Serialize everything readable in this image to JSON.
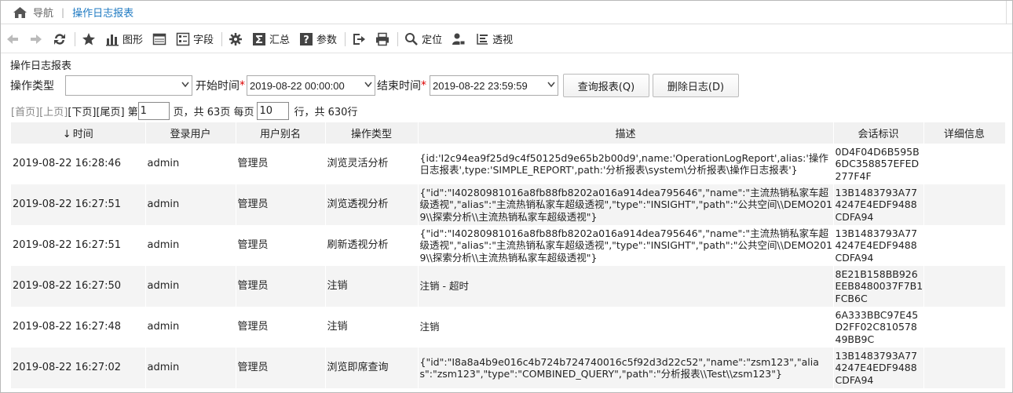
{
  "breadcrumb": {
    "nav": "导航",
    "current": "操作日志报表"
  },
  "toolbar": {
    "chart": "图形",
    "fields": "字段",
    "summary": "汇总",
    "params": "参数",
    "locate": "定位",
    "pivot": "透视"
  },
  "report": {
    "title": "操作日志报表"
  },
  "filter": {
    "op_type_label": "操作类型",
    "op_type_value": "",
    "start_label": "开始时间",
    "start_value": "2019-08-22 00:00:00",
    "end_label": "结束时间",
    "end_value": "2019-08-22 23:59:59",
    "required_mark": "*",
    "query_btn": "查询报表(Q)",
    "delete_btn": "删除日志(D)"
  },
  "paging": {
    "first": "[首页]",
    "prev": "[上页]",
    "next": "[下页]",
    "last": "[尾页]",
    "page_prefix": "第",
    "page_value": "1",
    "page_suffix": "页，共 63页 每页",
    "rows_value": "10",
    "rows_suffix": "行，共 630行"
  },
  "table": {
    "sort_arrow": "↓",
    "headers": [
      "时间",
      "登录用户",
      "用户别名",
      "操作类型",
      "描述",
      "会话标识",
      "详细信息"
    ],
    "rows": [
      {
        "time": "2019-08-22  16:28:46",
        "user": "admin",
        "alias": "管理员",
        "op": "浏览灵活分析",
        "desc": "{id:'I2c94ea9f25d9c4f50125d9e65b2b00d9',name:'OperationLogReport',alias:'操作日志报表',type:'SIMPLE_REPORT',path:'分析报表\\system\\分析报表\\操作日志报表'}",
        "session": "0D4F04D6B595B6DC358857EFED277F4F",
        "detail": ""
      },
      {
        "time": "2019-08-22  16:27:51",
        "user": "admin",
        "alias": "管理员",
        "op": "浏览透视分析",
        "desc": "{\"id\":\"I40280981016a8fb88fb8202a016a914dea795646\",\"name\":\"主流热销私家车超级透视\",\"alias\":\"主流热销私家车超级透视\",\"type\":\"INSIGHT\",\"path\":\"公共空间\\\\DEMO2019\\\\探索分析\\\\主流热销私家车超级透视\"}",
        "session": "13B1483793A774247E4EDF9488CDFA94",
        "detail": ""
      },
      {
        "time": "2019-08-22  16:27:51",
        "user": "admin",
        "alias": "管理员",
        "op": "刷新透视分析",
        "desc": "{\"id\":\"I40280981016a8fb88fb8202a016a914dea795646\",\"name\":\"主流热销私家车超级透视\",\"alias\":\"主流热销私家车超级透视\",\"type\":\"INSIGHT\",\"path\":\"公共空间\\\\DEMO2019\\\\探索分析\\\\主流热销私家车超级透视\"}",
        "session": "13B1483793A774247E4EDF9488CDFA94",
        "detail": ""
      },
      {
        "time": "2019-08-22  16:27:50",
        "user": "admin",
        "alias": "管理员",
        "op": "注销",
        "desc": "注销 - 超时",
        "session": "8E21B158BB926EEB8480037F7B1FCB6C",
        "detail": ""
      },
      {
        "time": "2019-08-22  16:27:48",
        "user": "admin",
        "alias": "管理员",
        "op": "注销",
        "desc": "注销",
        "session": "6A333BBC97E45D2FF02C81057849BB9C",
        "detail": ""
      },
      {
        "time": "2019-08-22  16:27:02",
        "user": "admin",
        "alias": "管理员",
        "op": "浏览即席查询",
        "desc": "{\"id\":\"I8a8a4b9e016c4b724b724740016c5f92d3d22c52\",\"name\":\"zsm123\",\"alias\":\"zsm123\",\"type\":\"COMBINED_QUERY\",\"path\":\"分析报表\\\\Test\\\\zsm123\"}",
        "session": "13B1483793A774247E4EDF9488CDFA94",
        "detail": ""
      }
    ]
  },
  "icons": {
    "home": "home-icon",
    "back": "arrow-left-icon",
    "forward": "arrow-right-icon",
    "refresh": "refresh-icon",
    "favorite": "star-icon",
    "chart": "bar-chart-icon",
    "layout": "layout-icon",
    "fields": "fields-icon",
    "settings": "gear-icon",
    "summary": "sigma-icon",
    "params": "question-icon",
    "export": "export-icon",
    "print": "printer-icon",
    "locate": "search-icon",
    "permission": "user-lock-icon",
    "pivot": "pivot-icon"
  }
}
